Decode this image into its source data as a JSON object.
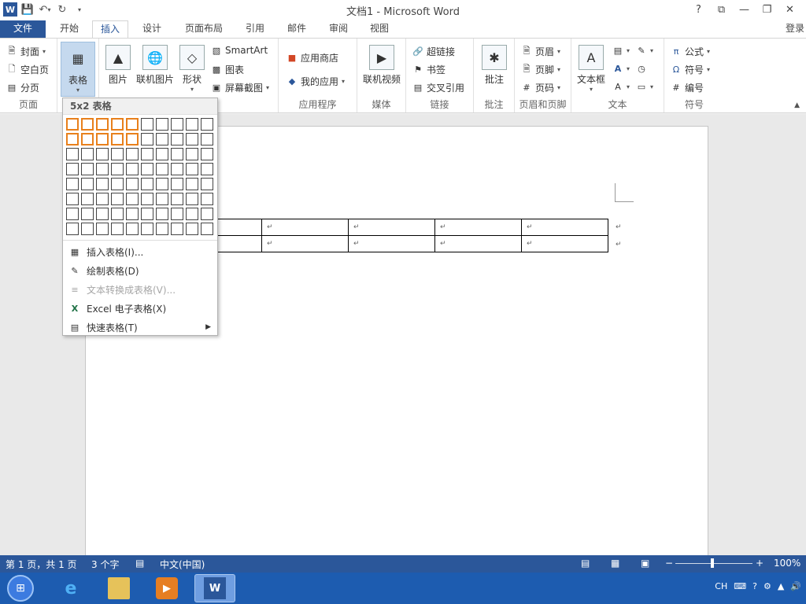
{
  "title_bar": {
    "title": "文档1 - Microsoft Word",
    "icons": [
      "word-app-icon",
      "save-icon",
      "undo-icon",
      "redo-icon",
      "customize-qat-icon"
    ],
    "window_controls": {
      "help": "?",
      "ribbon_display": "⧉",
      "minimize": "—",
      "restore": "❐",
      "close": "✕"
    }
  },
  "tabs": {
    "file": "文件",
    "home": "开始",
    "insert": "插入",
    "design": "设计",
    "layout": "页面布局",
    "references": "引用",
    "mailings": "邮件",
    "review": "审阅",
    "view": "视图",
    "login": "登录"
  },
  "ribbon": {
    "pages": {
      "cover": "封面",
      "blank": "空白页",
      "break": "分页",
      "label": "页面"
    },
    "tables": {
      "table": "表格"
    },
    "illustrations": {
      "pictures": "图片",
      "online_pictures": "联机图片",
      "shapes": "形状",
      "smartart": "SmartArt",
      "chart": "图表",
      "screenshot": "屏幕截图"
    },
    "apps": {
      "store": "应用商店",
      "my_apps": "我的应用",
      "label": "应用程序"
    },
    "media": {
      "online_video": "联机视频",
      "label": "媒体"
    },
    "links": {
      "hyperlink": "超链接",
      "bookmark": "书签",
      "cross_ref": "交叉引用",
      "label": "链接"
    },
    "comments": {
      "comment": "批注",
      "label": "批注"
    },
    "header_footer": {
      "header": "页眉",
      "footer": "页脚",
      "page_number": "页码",
      "label": "页眉和页脚"
    },
    "text": {
      "textbox": "文本框",
      "label": "文本"
    },
    "symbols": {
      "equation": "公式",
      "symbol": "符号",
      "number": "编号",
      "label": "符号"
    }
  },
  "table_dropdown": {
    "header": "5x2 表格",
    "grid": {
      "cols": 10,
      "rows": 8,
      "selected_cols": 5,
      "selected_rows": 2
    },
    "menu": [
      {
        "label": "插入表格(I)...",
        "enabled": true,
        "icon": "insert-table-icon"
      },
      {
        "label": "绘制表格(D)",
        "enabled": true,
        "icon": "draw-table-icon"
      },
      {
        "label": "文本转换成表格(V)...",
        "enabled": false,
        "icon": "text-to-table-icon"
      },
      {
        "label": "Excel 电子表格(X)",
        "enabled": true,
        "icon": "excel-icon"
      },
      {
        "label": "快速表格(T)",
        "enabled": true,
        "icon": "quick-table-icon",
        "submenu": true
      }
    ]
  },
  "document": {
    "table": {
      "rows": 2,
      "cols": 5,
      "cell_mark": "↵"
    }
  },
  "status_bar": {
    "page": "第 1 页，共 1 页",
    "words": "3 个字",
    "language": "中文(中国)",
    "zoom": "100%",
    "zoom_level": 1.0
  },
  "taskbar": {
    "apps": [
      "ie-icon",
      "explorer-icon",
      "media-player-icon",
      "word-icon"
    ],
    "tray_lang": "CH"
  },
  "colors": {
    "word_blue": "#2b579a",
    "selection_orange": "#e8801c",
    "taskbar": "#1d5cb0"
  }
}
